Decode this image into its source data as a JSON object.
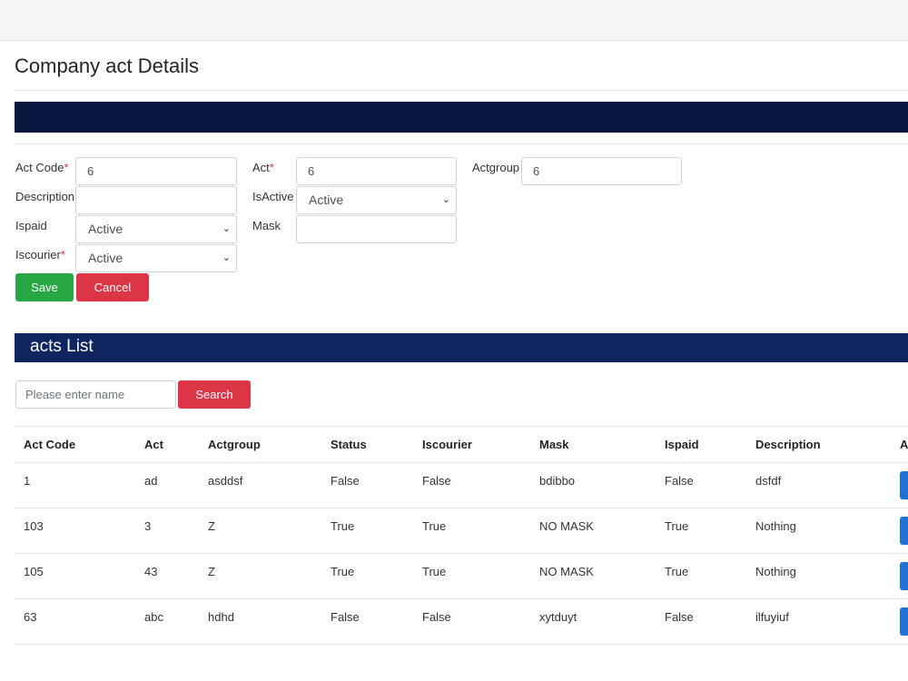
{
  "page": {
    "title": "Company act Details"
  },
  "form": {
    "act_code": {
      "label": "Act Code",
      "required": "*",
      "value": "6"
    },
    "act": {
      "label": "Act",
      "required": "*",
      "value": "6"
    },
    "actgroup": {
      "label": "Actgroup",
      "value": "6"
    },
    "description": {
      "label": "Description",
      "value": ""
    },
    "isactive": {
      "label": "IsActive",
      "value": "Active"
    },
    "ispaid": {
      "label": "Ispaid",
      "value": "Active"
    },
    "mask": {
      "label": "Mask",
      "value": ""
    },
    "iscourier": {
      "label": "Iscourier",
      "required": "*",
      "value": "Active"
    },
    "save_label": "Save",
    "cancel_label": "Cancel"
  },
  "list": {
    "title": "acts List",
    "search_placeholder": "Please enter name",
    "search_label": "Search",
    "columns": [
      "Act Code",
      "Act",
      "Actgroup",
      "Status",
      "Iscourier",
      "Mask",
      "Ispaid",
      "Description",
      "A"
    ],
    "rows": [
      [
        "1",
        "ad",
        "asddsf",
        "False",
        "False",
        "bdibbo",
        "False",
        "dsfdf"
      ],
      [
        "103",
        "3",
        "Z",
        "True",
        "True",
        "NO MASK",
        "True",
        "Nothing"
      ],
      [
        "105",
        "43",
        "Z",
        "True",
        "True",
        "NO MASK",
        "True",
        "Nothing"
      ],
      [
        "63",
        "abc",
        "hdhd",
        "False",
        "False",
        "xytduyt",
        "False",
        "ilfuyiuf"
      ]
    ]
  },
  "colors": {
    "header_band": "#07173d",
    "list_band": "#0e2560",
    "save": "#28a745",
    "cancel": "#dc3545",
    "row_action": "#1f72d6"
  }
}
